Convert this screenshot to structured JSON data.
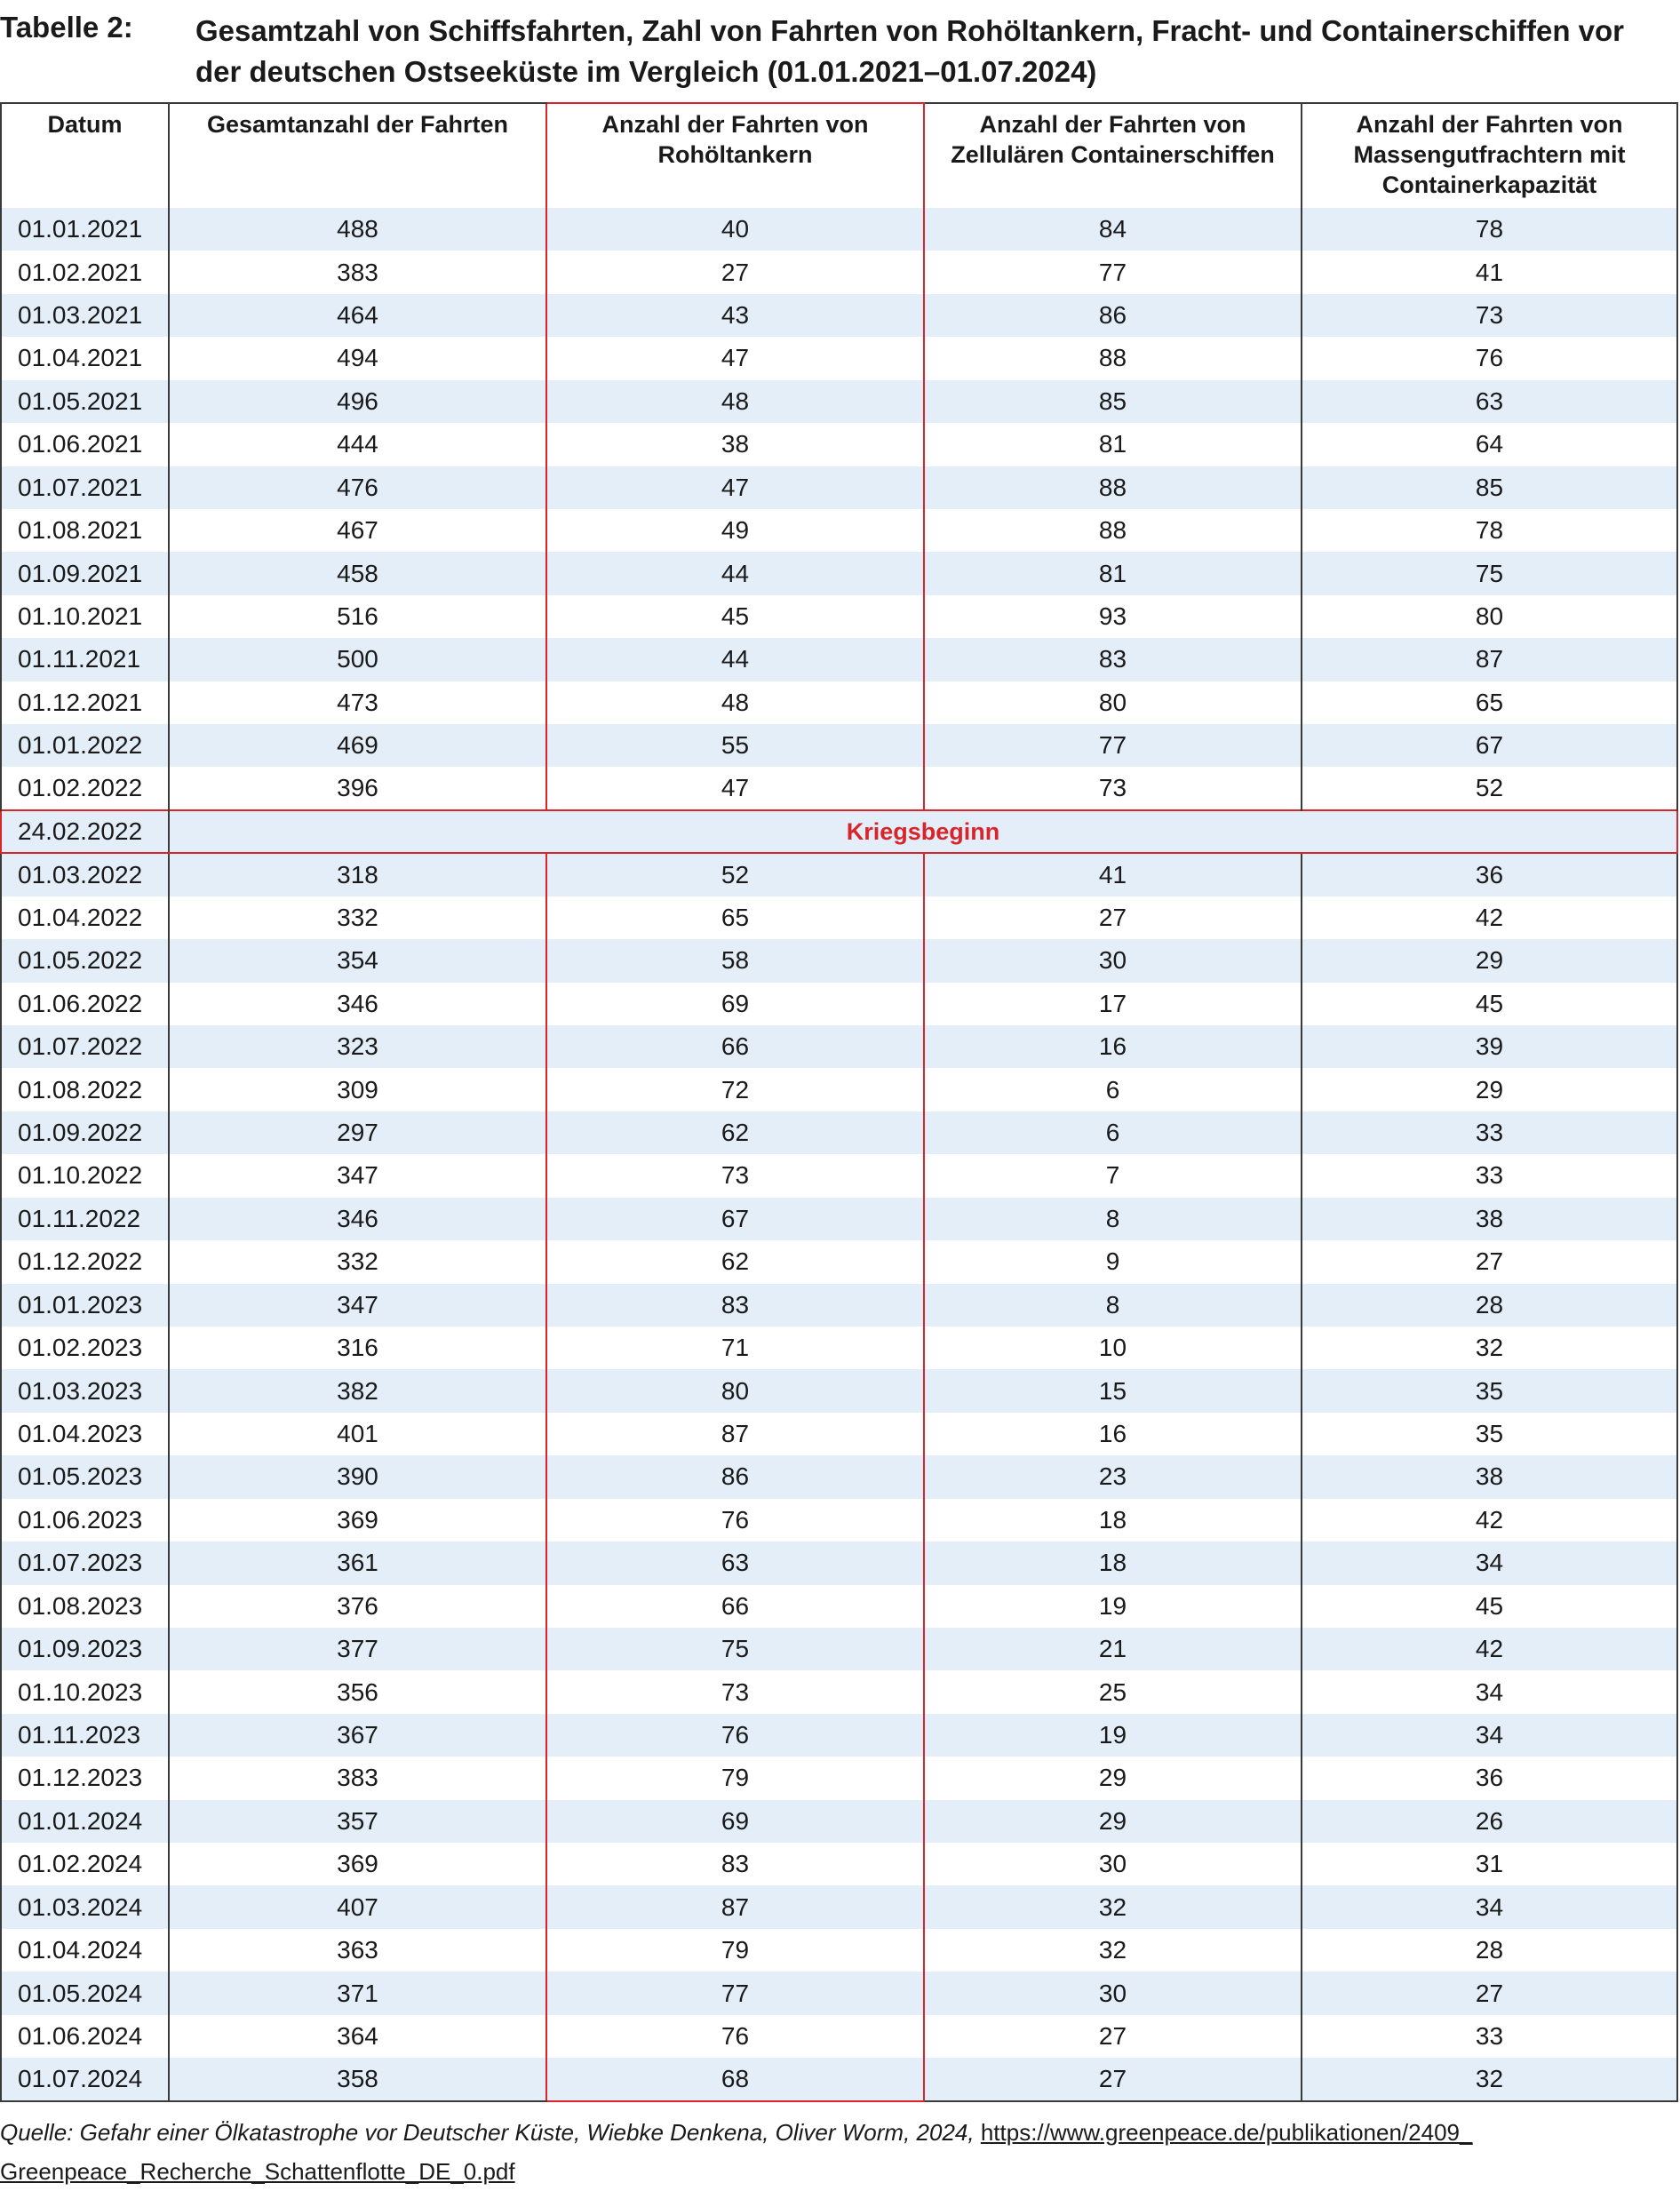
{
  "caption": {
    "label": "Tabelle 2:",
    "title": "Gesamtzahl von Schiffsfahrten, Zahl von Fahrten von Rohöltankern, Fracht- und Containerschiffen vor der deutschen Ostseeküste im Vergleich (01.01.2021–01.07.2024)"
  },
  "headers": [
    "Datum",
    "Gesamtanzahl der Fahrten",
    "Anzahl der Fahrten von Rohöltankern",
    "Anzahl der Fahrten von Zellulären Containerschiffen",
    "Anzahl der Fahrten von Massengutfrachtern mit Containerkapazität"
  ],
  "rows_before": [
    [
      "01.01.2021",
      "488",
      "40",
      "84",
      "78"
    ],
    [
      "01.02.2021",
      "383",
      "27",
      "77",
      "41"
    ],
    [
      "01.03.2021",
      "464",
      "43",
      "86",
      "73"
    ],
    [
      "01.04.2021",
      "494",
      "47",
      "88",
      "76"
    ],
    [
      "01.05.2021",
      "496",
      "48",
      "85",
      "63"
    ],
    [
      "01.06.2021",
      "444",
      "38",
      "81",
      "64"
    ],
    [
      "01.07.2021",
      "476",
      "47",
      "88",
      "85"
    ],
    [
      "01.08.2021",
      "467",
      "49",
      "88",
      "78"
    ],
    [
      "01.09.2021",
      "458",
      "44",
      "81",
      "75"
    ],
    [
      "01.10.2021",
      "516",
      "45",
      "93",
      "80"
    ],
    [
      "01.11.2021",
      "500",
      "44",
      "83",
      "87"
    ],
    [
      "01.12.2021",
      "473",
      "48",
      "80",
      "65"
    ],
    [
      "01.01.2022",
      "469",
      "55",
      "77",
      "67"
    ],
    [
      "01.02.2022",
      "396",
      "47",
      "73",
      "52"
    ]
  ],
  "war_row": {
    "date": "24.02.2022",
    "label": "Kriegsbeginn"
  },
  "rows_after": [
    [
      "01.03.2022",
      "318",
      "52",
      "41",
      "36"
    ],
    [
      "01.04.2022",
      "332",
      "65",
      "27",
      "42"
    ],
    [
      "01.05.2022",
      "354",
      "58",
      "30",
      "29"
    ],
    [
      "01.06.2022",
      "346",
      "69",
      "17",
      "45"
    ],
    [
      "01.07.2022",
      "323",
      "66",
      "16",
      "39"
    ],
    [
      "01.08.2022",
      "309",
      "72",
      "6",
      "29"
    ],
    [
      "01.09.2022",
      "297",
      "62",
      "6",
      "33"
    ],
    [
      "01.10.2022",
      "347",
      "73",
      "7",
      "33"
    ],
    [
      "01.11.2022",
      "346",
      "67",
      "8",
      "38"
    ],
    [
      "01.12.2022",
      "332",
      "62",
      "9",
      "27"
    ],
    [
      "01.01.2023",
      "347",
      "83",
      "8",
      "28"
    ],
    [
      "01.02.2023",
      "316",
      "71",
      "10",
      "32"
    ],
    [
      "01.03.2023",
      "382",
      "80",
      "15",
      "35"
    ],
    [
      "01.04.2023",
      "401",
      "87",
      "16",
      "35"
    ],
    [
      "01.05.2023",
      "390",
      "86",
      "23",
      "38"
    ],
    [
      "01.06.2023",
      "369",
      "76",
      "18",
      "42"
    ],
    [
      "01.07.2023",
      "361",
      "63",
      "18",
      "34"
    ],
    [
      "01.08.2023",
      "376",
      "66",
      "19",
      "45"
    ],
    [
      "01.09.2023",
      "377",
      "75",
      "21",
      "42"
    ],
    [
      "01.10.2023",
      "356",
      "73",
      "25",
      "34"
    ],
    [
      "01.11.2023",
      "367",
      "76",
      "19",
      "34"
    ],
    [
      "01.12.2023",
      "383",
      "79",
      "29",
      "36"
    ],
    [
      "01.01.2024",
      "357",
      "69",
      "29",
      "26"
    ],
    [
      "01.02.2024",
      "369",
      "83",
      "30",
      "31"
    ],
    [
      "01.03.2024",
      "407",
      "87",
      "32",
      "34"
    ],
    [
      "01.04.2024",
      "363",
      "79",
      "32",
      "28"
    ],
    [
      "01.05.2024",
      "371",
      "77",
      "30",
      "27"
    ],
    [
      "01.06.2024",
      "364",
      "76",
      "27",
      "33"
    ],
    [
      "01.07.2024",
      "358",
      "68",
      "27",
      "32"
    ]
  ],
  "source": {
    "text": "Quelle: Gefahr einer Ölkatastrophe vor Deutscher Küste, Wiebke Denkena, Oliver Worm, 2024, ",
    "url_line1": "https://www.greenpeace.de/publikationen/2409_",
    "url_line2": "Greenpeace_Recherche_Schattenflotte_DE_0.pdf"
  },
  "colors": {
    "highlight_red": "#d9252a",
    "stripe_blue": "#e3eef8",
    "border": "#3a3a3a"
  }
}
